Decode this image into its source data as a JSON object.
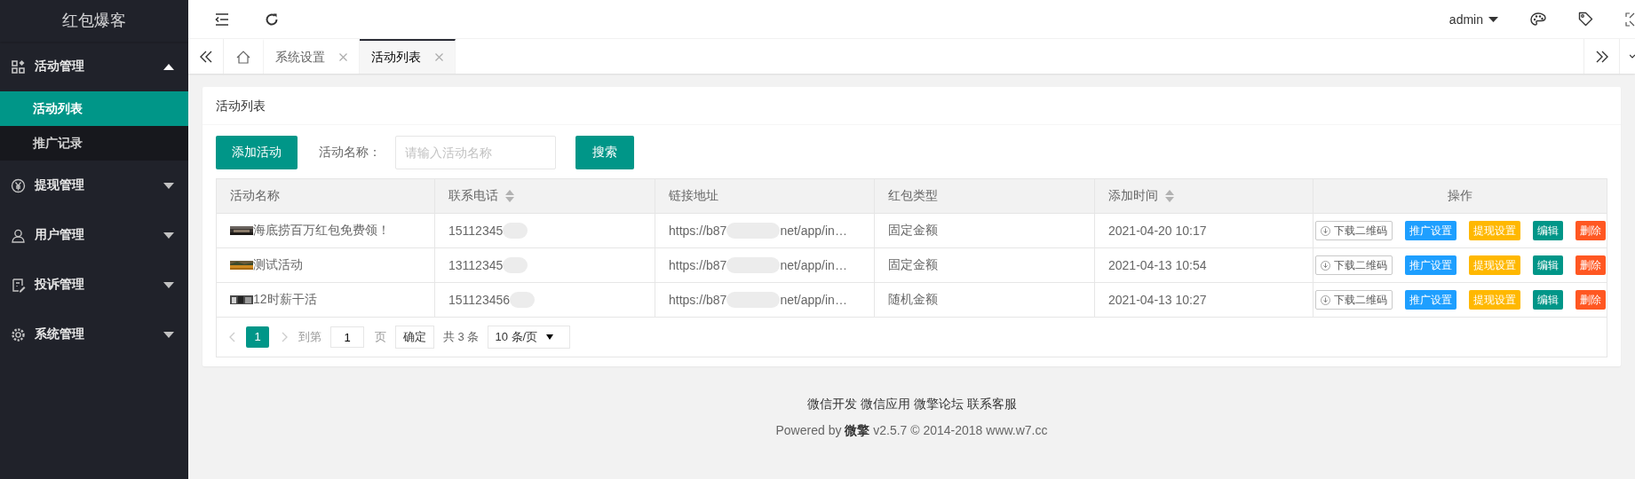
{
  "sidebar": {
    "brand": "红包爆客",
    "menu": [
      {
        "label": "活动管理",
        "kind": "apps",
        "expanded": true,
        "children": [
          {
            "label": "活动列表",
            "selected": true
          },
          {
            "label": "推广记录",
            "selected": false
          }
        ]
      },
      {
        "label": "提现管理",
        "kind": "yen",
        "expanded": false
      },
      {
        "label": "用户管理",
        "kind": "user",
        "expanded": false
      },
      {
        "label": "投诉管理",
        "kind": "note",
        "expanded": false
      },
      {
        "label": "系统管理",
        "kind": "gear",
        "expanded": false
      }
    ]
  },
  "header": {
    "user": "admin"
  },
  "tabs": [
    {
      "kind": "home",
      "selected": false
    },
    {
      "kind": "page",
      "label": "系统设置",
      "selected": false
    },
    {
      "kind": "page",
      "label": "活动列表",
      "selected": true
    }
  ],
  "card": {
    "title": "活动列表",
    "add_button": "添加活动",
    "search_label": "活动名称：",
    "search_placeholder": "请输入活动名称",
    "search_button": "搜索"
  },
  "table": {
    "columns": [
      {
        "label": "活动名称",
        "sortable": false
      },
      {
        "label": "联系电话",
        "sortable": true
      },
      {
        "label": "链接地址",
        "sortable": false
      },
      {
        "label": "红包类型",
        "sortable": false
      },
      {
        "label": "添加时间",
        "sortable": true
      },
      {
        "label": "操作",
        "sortable": false
      }
    ],
    "rows": [
      {
        "name": "海底捞百万红包免费领！",
        "phone": "15112345",
        "link_start": "https://b87",
        "link_end": "net/app/in…",
        "type": "固定金额",
        "time": "2021-04-20 10:17",
        "actions": [
          {
            "label": "下载二维码",
            "kind": "outline"
          },
          {
            "label": "推广设置",
            "kind": "filled",
            "color": "#1e9fff"
          },
          {
            "label": "提现设置",
            "kind": "filled",
            "color": "#ffb800"
          },
          {
            "label": "编辑",
            "kind": "filled",
            "color": "#009688"
          },
          {
            "label": "删除",
            "kind": "filled",
            "color": "#ff5722"
          }
        ]
      },
      {
        "name": "测试活动",
        "phone": "13112345",
        "link_start": "https://b87",
        "link_end": "net/app/in…",
        "type": "固定金额",
        "time": "2021-04-13 10:54",
        "actions": [
          {
            "label": "下载二维码",
            "kind": "outline"
          },
          {
            "label": "推广设置",
            "kind": "filled",
            "color": "#1e9fff"
          },
          {
            "label": "提现设置",
            "kind": "filled",
            "color": "#ffb800"
          },
          {
            "label": "编辑",
            "kind": "filled",
            "color": "#009688"
          },
          {
            "label": "删除",
            "kind": "filled",
            "color": "#ff5722"
          }
        ]
      },
      {
        "name": "12时薪干活",
        "phone": "151123456",
        "link_start": "https://b87",
        "link_end": "net/app/in…",
        "type": "随机金额",
        "time": "2021-04-13 10:27",
        "actions": [
          {
            "label": "下载二维码",
            "kind": "outline"
          },
          {
            "label": "推广设置",
            "kind": "filled",
            "color": "#1e9fff"
          },
          {
            "label": "提现设置",
            "kind": "filled",
            "color": "#ffb800"
          },
          {
            "label": "编辑",
            "kind": "filled",
            "color": "#009688"
          },
          {
            "label": "删除",
            "kind": "filled",
            "color": "#ff5722"
          }
        ]
      }
    ]
  },
  "pager": {
    "pages": [
      {
        "label": "1",
        "selected": true
      }
    ],
    "goto_label": "到第",
    "page_value": "1",
    "page_unit": "页",
    "confirm": "确定",
    "total": "共 3 条",
    "size": "10 条/页"
  },
  "footer": {
    "links": [
      "微信开发",
      "微信应用",
      "微擎论坛",
      "联系客服"
    ],
    "powered": "Powered by **微擎** v2.5.7 © 2014-2018 www.w7.cc"
  }
}
